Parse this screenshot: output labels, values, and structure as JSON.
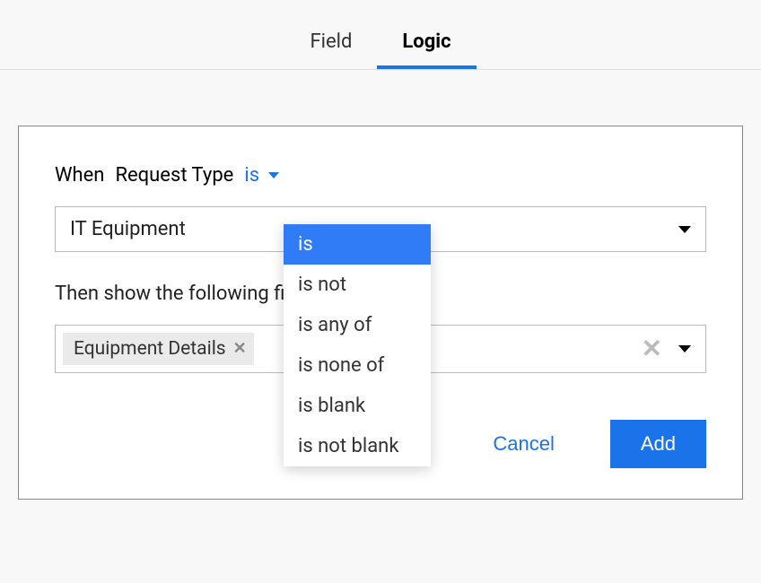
{
  "tabs": {
    "field": "Field",
    "logic": "Logic"
  },
  "condition": {
    "when_label": "When",
    "field_name": "Request Type",
    "operator_selected": "is",
    "operator_options": [
      "is",
      "is not",
      "is any of",
      "is none of",
      "is blank",
      "is not blank"
    ],
    "value_selected": "IT Equipment"
  },
  "then": {
    "label": "Then show the following fields",
    "chips": [
      {
        "label": "Equipment Details"
      }
    ]
  },
  "actions": {
    "cancel": "Cancel",
    "add": "Add"
  },
  "colors": {
    "accent": "#1a73e8"
  }
}
